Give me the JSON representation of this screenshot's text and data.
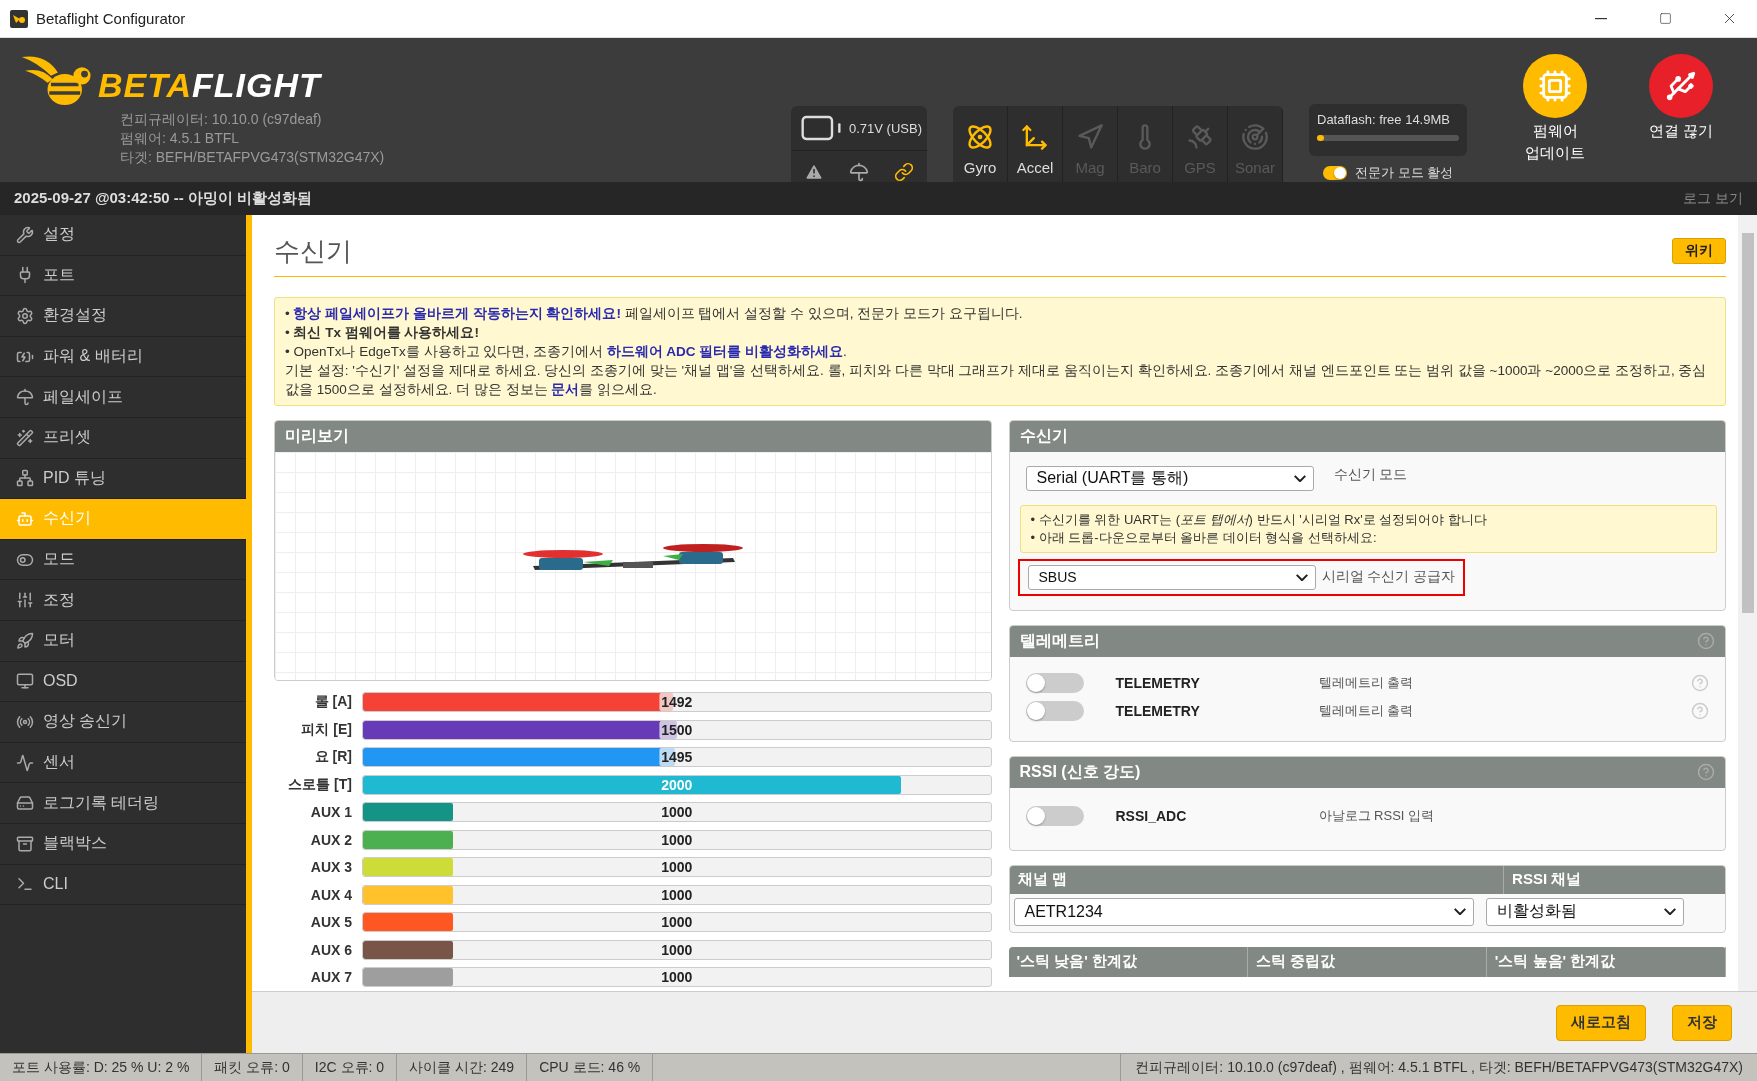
{
  "window": {
    "title": "Betaflight Configurator"
  },
  "header": {
    "logo": {
      "part1": "BETA",
      "part2": "FLIGHT"
    },
    "versions": [
      "컨피규레이터: 10.10.0 (c97deaf)",
      "펌웨어: 4.5.1 BTFL",
      "타겟: BEFH/BETAFPVG473(STM32G47X)"
    ],
    "battery": {
      "reading": "0.71V (USB)"
    },
    "sensors": [
      {
        "kind": "gyro",
        "label": "Gyro",
        "active": true
      },
      {
        "kind": "accel",
        "label": "Accel",
        "active": true
      },
      {
        "kind": "mag",
        "label": "Mag",
        "active": false
      },
      {
        "kind": "baro",
        "label": "Baro",
        "active": false
      },
      {
        "kind": "gps",
        "label": "GPS",
        "active": false
      },
      {
        "kind": "sonar",
        "label": "Sonar",
        "active": false
      }
    ],
    "dataflash": {
      "label": "Dataflash: free 14.9MB",
      "level": 0.05
    },
    "expert_mode": {
      "label": "전문가 모드 활성",
      "on": true
    },
    "firmware_button": {
      "lines": [
        "펌웨어",
        "업데이트"
      ]
    },
    "disconnect_button": {
      "label": "연결 끊기"
    }
  },
  "log_bar": {
    "message": "2025-09-27 @03:42:50 -- 아밍이 비활성화됨",
    "link": "로그 보기"
  },
  "sidebar": {
    "items": [
      {
        "kind": "wrench",
        "label": "설정",
        "selected": false
      },
      {
        "kind": "plug",
        "label": "포트",
        "selected": false
      },
      {
        "kind": "gear",
        "label": "환경설정",
        "selected": false
      },
      {
        "kind": "battery",
        "label": "파워 & 배터리",
        "selected": false
      },
      {
        "kind": "umbrella",
        "label": "페일세이프",
        "selected": false
      },
      {
        "kind": "wand",
        "label": "프리셋",
        "selected": false
      },
      {
        "kind": "network",
        "label": "PID 튜닝",
        "selected": false
      },
      {
        "kind": "robot",
        "label": "수신기",
        "selected": true
      },
      {
        "kind": "toggle",
        "label": "모드",
        "selected": false
      },
      {
        "kind": "sliders",
        "label": "조정",
        "selected": false
      },
      {
        "kind": "rocket",
        "label": "모터",
        "selected": false
      },
      {
        "kind": "monitor",
        "label": "OSD",
        "selected": false
      },
      {
        "kind": "radio",
        "label": "영상 송신기",
        "selected": false
      },
      {
        "kind": "pulse",
        "label": "센서",
        "selected": false
      },
      {
        "kind": "drive",
        "label": "로그기록 테더링",
        "selected": false
      },
      {
        "kind": "archive",
        "label": "블랙박스",
        "selected": false
      },
      {
        "kind": "terminal",
        "label": "CLI",
        "selected": false
      }
    ]
  },
  "page": {
    "title": "수신기",
    "wiki_button": "위키"
  },
  "notice": {
    "lines": [
      [
        {
          "kind": "plain",
          "text": "• "
        },
        {
          "kind": "emphasis",
          "text": "항상 페일세이프가 올바르게 작동하는지 확인하세요!"
        },
        {
          "kind": "plain",
          "text": " 페일세이프 탭에서 설정할 수 있으며, 전문가 모드가 요구됩니다."
        }
      ],
      [
        {
          "kind": "plain",
          "text": "• "
        },
        {
          "kind": "strong",
          "text": "최신 Tx 펌웨어를 사용하세요!"
        }
      ],
      [
        {
          "kind": "plain",
          "text": "• OpenTx나 EdgeTx를 사용하고 있다면, 조종기에서 "
        },
        {
          "kind": "link",
          "text": "하드웨어 ADC 필터를 비활성화하세요"
        },
        {
          "kind": "plain",
          "text": "."
        }
      ],
      [
        {
          "kind": "plain",
          "text": "기본 설정: '수신기' 설정을 제대로 하세요. 당신의 조종기에 맞는 '채널 맵'을 선택하세요. 롤, 피치와 다른 막대 그래프가 제대로 움직이는지 확인하세요. 조종기에서 채널 엔드포인트 또는 범위 값을 ~1000과 ~2000으로 조정하고, 중심값을 1500으로 설정하세요. 더 많은 정보는 "
        },
        {
          "kind": "link",
          "text": "문서"
        },
        {
          "kind": "plain",
          "text": "를 읽으세요."
        }
      ]
    ]
  },
  "preview": {
    "title": "미리보기"
  },
  "channels": [
    {
      "label": "롤 [A]",
      "value": "1492",
      "level": 0.494,
      "color": "#f44336"
    },
    {
      "label": "피치 [E]",
      "value": "1500",
      "level": 0.5,
      "color": "#673ab7"
    },
    {
      "label": "요 [R]",
      "value": "1495",
      "level": 0.497,
      "color": "#2196f3"
    },
    {
      "label": "스로틀 [T]",
      "value": "2000",
      "level": 0.857,
      "color": "#1fbad2"
    },
    {
      "label": "AUX 1",
      "value": "1000",
      "level": 0.143,
      "color": "#139487"
    },
    {
      "label": "AUX 2",
      "value": "1000",
      "level": 0.143,
      "color": "#4caf50"
    },
    {
      "label": "AUX 3",
      "value": "1000",
      "level": 0.143,
      "color": "#cddc39"
    },
    {
      "label": "AUX 4",
      "value": "1000",
      "level": 0.143,
      "color": "#ffc12c"
    },
    {
      "label": "AUX 5",
      "value": "1000",
      "level": 0.143,
      "color": "#ff5722"
    },
    {
      "label": "AUX 6",
      "value": "1000",
      "level": 0.143,
      "color": "#795548"
    },
    {
      "label": "AUX 7",
      "value": "1000",
      "level": 0.143,
      "color": "#9e9e9e"
    }
  ],
  "receiver": {
    "title": "수신기",
    "mode_value": "Serial (UART를 통해)",
    "mode_label": "수신기 모드",
    "note": [
      "• 수신기를 위한 UART는 (*포트 탭에서*) 반드시 '시리얼 Rx'로 설정되어야 합니다",
      "• 아래 드롭-다운으로부터 올바른 데이터 형식을 선택하세요:"
    ],
    "provider": {
      "value": "SBUS",
      "label": "시리얼 수신기 공급자",
      "highlighted": true
    }
  },
  "telemetry": {
    "title": "텔레메트리",
    "features": [
      {
        "name": "TELEMETRY",
        "description": "텔레메트리 출력",
        "on": false
      },
      {
        "name": "TELEMETRY",
        "description": "텔레메트리 출력",
        "on": false
      }
    ]
  },
  "rssi": {
    "title": "RSSI (신호 강도)",
    "features": [
      {
        "name": "RSSI_ADC",
        "description": "아날로그 RSSI 입력",
        "on": false
      }
    ]
  },
  "channel_map": {
    "title": "채널 맵",
    "value": "AETR1234",
    "rssi_title": "RSSI 채널",
    "rssi_value": "비활성화됨"
  },
  "stick_table": {
    "columns": [
      "'스틱 낮음' 한계값",
      "스틱 중립값",
      "'스틱 높음' 한계값"
    ]
  },
  "buttons": [
    {
      "label": "새로고침"
    },
    {
      "label": "저장"
    }
  ],
  "status_bar": {
    "items": [
      "포트 사용률: D: 25 % U: 2 %",
      "패킷 오류: 0",
      "I2C 오류: 0",
      "사이클 시간: 249",
      "CPU 로드: 46 %"
    ],
    "version": "컨피규레이터: 10.10.0 (c97deaf) , 펌웨어: 4.5.1 BTFL , 타겟: BEFH/BETAFPVG473(STM32G47X)"
  }
}
